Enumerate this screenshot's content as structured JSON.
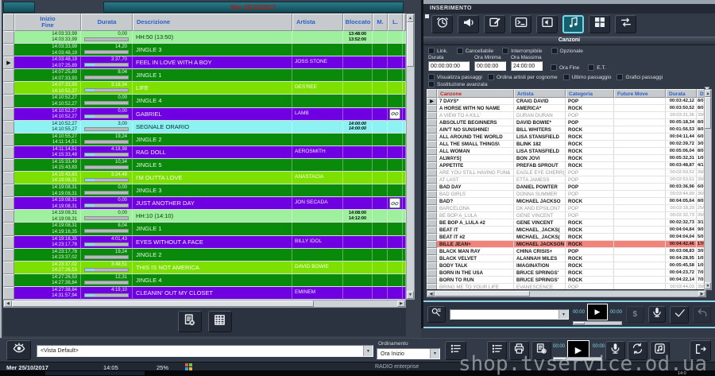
{
  "window": {
    "playlist_header_date": "Mer 25/10/2017",
    "watermark": "shop.tvservice.od.ua",
    "status": {
      "date": "Mer 25/10/2017",
      "time": "14:05",
      "percent": "25%",
      "app_name": "RADIO enterprise",
      "taskbar_clock": "14:0"
    }
  },
  "colors": {
    "row_hour_marker": "#9ef09e",
    "row_jingle": "#0a8a0a",
    "row_song": "#6f00e2",
    "row_hit": "#7ee000",
    "row_time_signal": "#8ef2f2",
    "selected_song_row": "#f2837b",
    "accent_cyan": "#72d7e9",
    "header_teal": "#1f6a79",
    "canzone_header_red": "#c0241c",
    "grid_header_blue": "#2b5fc7"
  },
  "playlist": {
    "columns": {
      "inizio": "Inizio",
      "fine": "Fine",
      "durata": "Durata",
      "descrizione": "Descrizione",
      "artista": "Artista",
      "bloccato": "Bloccato",
      "m": "M.",
      "l": "L."
    },
    "bottom_icons": [
      "remove-document",
      "grid-table"
    ],
    "rows": [
      {
        "i": "14:03:33,99",
        "f": "14:03:33,99",
        "d": "0,00",
        "t": "HH:50 (13:50)",
        "a": "",
        "type": "mint",
        "b": [
          "13:48:00",
          "13:52:00"
        ]
      },
      {
        "i": "14:03:33,99",
        "f": "14:03:48,19",
        "d": "14,20",
        "t": "JINGLE 3",
        "a": "",
        "type": "jin"
      },
      {
        "i": "14:03:48,19",
        "f": "14:07:25,89",
        "d": "3:37,70",
        "t": "FEEL IN LOVE WITH A BOY",
        "a": "JOSS STONE",
        "type": "pur",
        "cur": true
      },
      {
        "i": "14:07:25,89",
        "f": "14:07:33,93",
        "d": "8,04",
        "t": "JINGLE 1",
        "a": "",
        "type": "jin"
      },
      {
        "i": "14:07:33,93",
        "f": "14:10:52,27",
        "d": "3:18,34",
        "t": "LIFE",
        "a": "DES'REE",
        "type": "lim"
      },
      {
        "i": "14:10:52,27",
        "f": "14:10:52,27",
        "d": "0,00",
        "t": "JINGLE 4",
        "a": "",
        "type": "jin"
      },
      {
        "i": "14:10:52,27",
        "f": "14:10:52,27",
        "d": "0,00",
        "t": "GABRIEL",
        "a": "LAMB",
        "type": "pur",
        "link": true
      },
      {
        "i": "14:10:52,27",
        "f": "14:10:55,27",
        "d": "3,00",
        "t": "SEGNALE ORARIO",
        "a": "",
        "type": "cyn",
        "b": [
          "14:00:00",
          "14:00:00"
        ],
        "it": true
      },
      {
        "i": "14:10:55,27",
        "f": "14:11:14,51",
        "d": "19,24",
        "t": "JINGLE 2",
        "a": "",
        "type": "jin"
      },
      {
        "i": "14:11:14,51",
        "f": "14:15:33,48",
        "d": "4:18,98",
        "t": "RAG DOLL",
        "a": "AEROSMITH",
        "type": "pur"
      },
      {
        "i": "14:15:33,49",
        "f": "14:15:43,83",
        "d": "10,34",
        "t": "JINGLE 5",
        "a": "",
        "type": "jin"
      },
      {
        "i": "14:15:43,83",
        "f": "14:19:08,31",
        "d": "3:24,48",
        "t": "I'M OUTTA LOVE",
        "a": "ANASTACIA",
        "type": "lim"
      },
      {
        "i": "14:19:08,31",
        "f": "14:19:08,31",
        "d": "0,00",
        "t": "JINGLE 3",
        "a": "",
        "type": "jin"
      },
      {
        "i": "14:19:08,31",
        "f": "14:19:08,31",
        "d": "0,00",
        "t": "JUST ANOTHER DAY",
        "a": "JON SECADA",
        "type": "pur",
        "link": true
      },
      {
        "i": "14:19:08,31",
        "f": "14:19:08,31",
        "d": "0,00",
        "t": "HH:10 (14:10)",
        "a": "",
        "type": "mint",
        "b": [
          "14:08:00",
          "14:12:00"
        ]
      },
      {
        "i": "14:19:08,31",
        "f": "14:19:16,35",
        "d": "8,04",
        "t": "JINGLE 1",
        "a": "",
        "type": "jin"
      },
      {
        "i": "14:19:16,35",
        "f": "14:23:17,78",
        "d": "4:01,43",
        "t": "EYES WITHOUT A FACE",
        "a": "BILLY IDOL",
        "type": "pur"
      },
      {
        "i": "14:23:17,78",
        "f": "14:23:37,02",
        "d": "19,24",
        "t": "JINGLE 2",
        "a": "",
        "type": "jin"
      },
      {
        "i": "14:23:37,02",
        "f": "14:27:26,53",
        "d": "3:49,51",
        "t": "THIS IS NOT AMERICA",
        "a": "DAVID BOWIE",
        "type": "lim"
      },
      {
        "i": "14:27:26,53",
        "f": "14:27:38,84",
        "d": "12,31",
        "t": "JINGLE 4",
        "a": "",
        "type": "jin"
      },
      {
        "i": "14:27:38,84",
        "f": "14:31:57,94",
        "d": "4:19,10",
        "t": "CLEANIN' OUT MY CLOSET",
        "a": "EMINEM",
        "type": "pur"
      }
    ]
  },
  "inserimento": {
    "title": "INSERIMENTO",
    "section_title": "Canzoni",
    "toolbar_icons": [
      "clock",
      "announcement",
      "edit",
      "command-window",
      "audio-file",
      "music-note",
      "grid",
      "exchange"
    ],
    "selected_tool": "music-note",
    "filters": {
      "link": "Link.",
      "cancellabile": "Cancellabile",
      "interrompibile": "Interrompibile",
      "opzionale": "Opzionale",
      "ora_fine": "Ora Fine",
      "et": "E.T.",
      "visualizza": "Visualizza passaggi",
      "ordina": "Ordina artisti per cognome",
      "ultimo": "Ultimo passaggio",
      "grafici": "Grafici passaggi",
      "sostituzione": "Sostituzione avanzata"
    },
    "field_labels": {
      "durata": "Durata",
      "ora_minima": "Ora Minima",
      "ora_massima": "Ora Massima"
    },
    "fields": {
      "durata": "00:00:00:00",
      "ora_minima": "00:00:00",
      "ora_massima": "24:00:00"
    },
    "songs": {
      "columns": [
        "Canzone",
        "Artista",
        "Categoria",
        "Future Move",
        "Durata",
        "D"
      ],
      "rows": [
        {
          "c": "7 DAYS*",
          "a": "CRAIG DAVID",
          "cat": "POP",
          "d": "00:03:42,12",
          "n": "8/0",
          "st": "b",
          "cur": true
        },
        {
          "c": "A HORSE WITH NO NAME",
          "a": "AMERICA*",
          "cat": "ROCK",
          "d": "00:03:50,52",
          "n": "8/0",
          "st": "b"
        },
        {
          "c": "A VIEW TO A KILL'",
          "a": "DURAN DURAN",
          "cat": "POP",
          "d": "00:03:31,36",
          "n": "39/0",
          "st": "g"
        },
        {
          "c": "ABSOLUTE BEGINNERS",
          "a": "DAVID BOWIE*",
          "cat": "POP",
          "d": "00:05:18,34",
          "n": "8/0",
          "st": "b"
        },
        {
          "c": "AIN'T NO SUNSHINE!",
          "a": "BILL WHITERS",
          "cat": "ROCK",
          "d": "00:01:56,53",
          "n": "8/0",
          "st": "b"
        },
        {
          "c": "ALL AROUND THE WORLD",
          "a": "LISA STANSFIELD",
          "cat": "ROCK",
          "d": "00:04:11,44",
          "n": "6/0",
          "st": "b"
        },
        {
          "c": "ALL THE SMALL THINGS\\",
          "a": "BLINK 182",
          "cat": "ROCK",
          "d": "00:02:39,72",
          "n": "3/0",
          "st": "b"
        },
        {
          "c": "ALL WOMAN",
          "a": "LISA STANSFIELD",
          "cat": "ROCK",
          "d": "00:05:06,04",
          "n": "8/0",
          "st": "b"
        },
        {
          "c": "ALWAYS]",
          "a": "BON JOVI",
          "cat": "ROCK",
          "d": "00:05:32,31",
          "n": "1/0",
          "st": "b"
        },
        {
          "c": "APPETITE",
          "a": "PREFAB SPROUT",
          "cat": "ROCK",
          "d": "00:03:48,87",
          "n": "4/1",
          "st": "b"
        },
        {
          "c": "ARE YOU STILL HAVING FUN&",
          "a": "EAGLE EYE CHERR(",
          "cat": "POP",
          "d": "00:02:59,52",
          "n": "39/0",
          "st": "g"
        },
        {
          "c": "AT LAST",
          "a": "ETTA JAMESS",
          "cat": "POP",
          "d": "00:02:53,61",
          "n": "39/0",
          "st": "g"
        },
        {
          "c": "BAD DAY",
          "a": "DANIEL POWTER",
          "cat": "POP",
          "d": "00:03:36,96",
          "n": "6/0",
          "st": "b"
        },
        {
          "c": "BAD GIRLS",
          "a": "DONNA SUMMER",
          "cat": "POP",
          "d": "00:03:44,99",
          "n": "36/0",
          "st": "g"
        },
        {
          "c": "BAD?",
          "a": "MICHAEL JACKSO",
          "cat": "ROCK",
          "d": "00:04:05,64",
          "n": "8/0",
          "st": "b"
        },
        {
          "c": "BARCELONA",
          "a": "DK AND EPSILON7",
          "cat": "POP",
          "d": "00:03:18,29",
          "n": "25/0",
          "st": "g"
        },
        {
          "c": "BE BOP A_LULA",
          "a": "GENE VINCENT",
          "cat": "POP",
          "d": "00:02:32,73",
          "n": "39/0",
          "st": "g"
        },
        {
          "c": "BE BOP A_LULA #2",
          "a": "GENE VINCENT",
          "cat": "ROCK",
          "d": "00:02:32,73",
          "n": "3/1",
          "st": "b"
        },
        {
          "c": "BEAT IT",
          "a": "MICHAEL_JACKS(",
          "cat": "ROCK",
          "d": "00:04:04,84",
          "n": "9/0",
          "st": "b"
        },
        {
          "c": "BEAT IT #2",
          "a": "MICHAEL_JACKS(",
          "cat": "ROCK",
          "d": "00:04:04,04",
          "n": "5/0",
          "st": "b"
        },
        {
          "c": "BILLE JEAN+",
          "a": "MICHAEL JACKSON",
          "cat": "ROCK",
          "d": "00:04:42,46",
          "n": "17/0",
          "st": "b",
          "sel": true
        },
        {
          "c": "BLACK MAN RAY",
          "a": "CHINA CRISIS+",
          "cat": "POP",
          "d": "00:03:08,83",
          "n": "3/0",
          "st": "b"
        },
        {
          "c": "BLACK VELVET",
          "a": "ALANNAH MILES",
          "cat": "ROCK",
          "d": "00:04:28,95",
          "n": "1/0",
          "st": "b"
        },
        {
          "c": "BODY TALK",
          "a": "IMAGINATION",
          "cat": "ROCK",
          "d": "00:05:45,58",
          "n": "1/0",
          "st": "b"
        },
        {
          "c": "BORN IN THE USA",
          "a": "BRUCE SPRINGS'",
          "cat": "ROCK",
          "d": "00:04:23,72",
          "n": "7/0",
          "st": "b"
        },
        {
          "c": "BORN TO RUN",
          "a": "BRUCE SPRINGS'",
          "cat": "ROCK",
          "d": "00:04:22,14",
          "n": "7/0",
          "st": "b"
        },
        {
          "c": "BRING ME TO YOUR LIFE",
          "a": "EVANESCENCE",
          "cat": "POP",
          "d": "00:03:44,03",
          "n": "39/0",
          "st": "g"
        }
      ]
    },
    "player": {
      "elapsed": "00:00",
      "remaining": "00:00",
      "search_value": "",
      "icons": [
        "search",
        "dollar",
        "microphone",
        "confirm",
        "undo"
      ]
    }
  },
  "bottom_toolbar": {
    "vista_combo_value": "<Vista Default>",
    "ordinamento_label": "Ordinamento",
    "ordinamento_value": "Ora Inizio",
    "elapsed": "00:00",
    "remaining": "00:00",
    "icons": [
      "eye",
      "playlist-add",
      "playlist-add",
      "printer",
      "report-settings",
      "play",
      "microphone",
      "refresh",
      "jingle-box",
      "exit"
    ]
  }
}
